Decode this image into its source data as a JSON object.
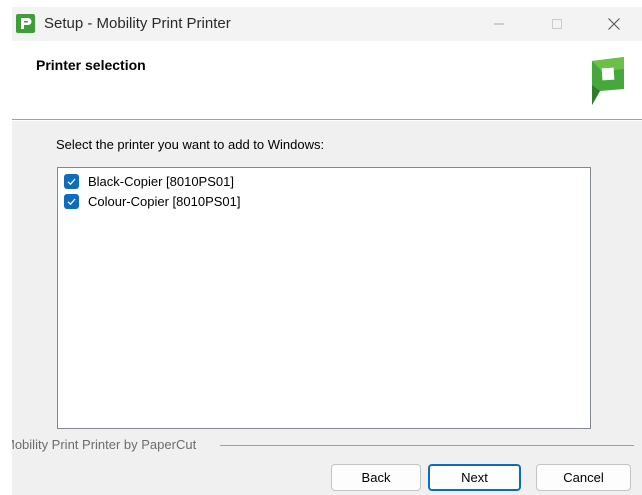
{
  "window": {
    "title": "Setup - Mobility Print Printer",
    "app_icon": "papercut-logo-icon"
  },
  "header": {
    "title": "Printer selection",
    "logo_icon": "papercut-logo-icon"
  },
  "main": {
    "instruction": "Select the printer you want to add to Windows:",
    "printers": [
      {
        "label": "Black-Copier [8010PS01]",
        "checked": true
      },
      {
        "label": "Colour-Copier [8010PS01]",
        "checked": true
      }
    ]
  },
  "footer": {
    "brand": "Mobility Print Printer by PaperCut",
    "back_label": "Back",
    "next_label": "Next",
    "cancel_label": "Cancel"
  },
  "colors": {
    "accent": "#0f6cbd",
    "brand_green": "#3f9e3a"
  }
}
